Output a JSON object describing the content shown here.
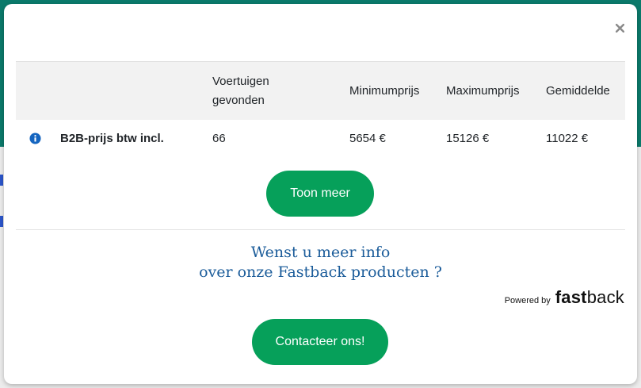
{
  "modal": {
    "close_icon": "close-icon"
  },
  "table": {
    "headers": [
      {
        "line1": "",
        "line2": ""
      },
      {
        "line1": "",
        "line2": ""
      },
      {
        "line1": "Voertuigen",
        "line2": "gevonden"
      },
      {
        "line1": "Minimumprijs",
        "line2": ""
      },
      {
        "line1": "Maximumprijs",
        "line2": ""
      },
      {
        "line1": "Gemiddelde",
        "line2": ""
      }
    ],
    "row": {
      "icon": "info-icon",
      "label": "B2B-prijs btw incl.",
      "vehicles": "66",
      "min_price": "5654 €",
      "max_price": "15126 €",
      "avg_price": "11022 €"
    }
  },
  "buttons": {
    "show_more": "Toon meer",
    "contact": "Contacteer ons!"
  },
  "cta": {
    "line1": "Wenst u meer info",
    "line2": "over onze Fastback producten ?"
  },
  "powered_by": {
    "text": "Powered by",
    "logo_bold": "fast",
    "logo_regular": "back"
  },
  "colors": {
    "accent_green": "#06a05a",
    "cta_blue": "#1b5c9a",
    "header_bg": "#f2f2f2",
    "info_icon_blue": "#1565c0"
  }
}
